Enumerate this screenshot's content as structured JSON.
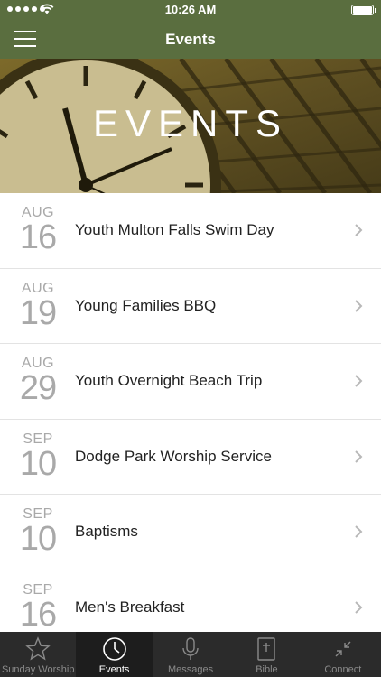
{
  "status_bar": {
    "time": "10:26 AM"
  },
  "nav": {
    "title": "Events",
    "menu_icon": "hamburger-menu-icon"
  },
  "hero": {
    "heading": "EVENTS"
  },
  "events": [
    {
      "month": "AUG",
      "day": "16",
      "name": "Youth Multon Falls Swim Day"
    },
    {
      "month": "AUG",
      "day": "19",
      "name": "Young Families BBQ"
    },
    {
      "month": "AUG",
      "day": "29",
      "name": "Youth Overnight Beach Trip"
    },
    {
      "month": "SEP",
      "day": "10",
      "name": "Dodge Park Worship Service"
    },
    {
      "month": "SEP",
      "day": "10",
      "name": "Baptisms"
    },
    {
      "month": "SEP",
      "day": "16",
      "name": "Men's Breakfast"
    }
  ],
  "tabs": [
    {
      "label": "Sunday Worship",
      "icon": "star-icon",
      "active": false
    },
    {
      "label": "Events",
      "icon": "clock-icon",
      "active": true
    },
    {
      "label": "Messages",
      "icon": "microphone-icon",
      "active": false
    },
    {
      "label": "Bible",
      "icon": "bible-icon",
      "active": false
    },
    {
      "label": "Connect",
      "icon": "connect-arrows-icon",
      "active": false
    }
  ],
  "colors": {
    "nav_bg": "#5a6e3f",
    "tabbar_bg": "#2b2b2b",
    "date_gray": "#a9a9a9"
  }
}
